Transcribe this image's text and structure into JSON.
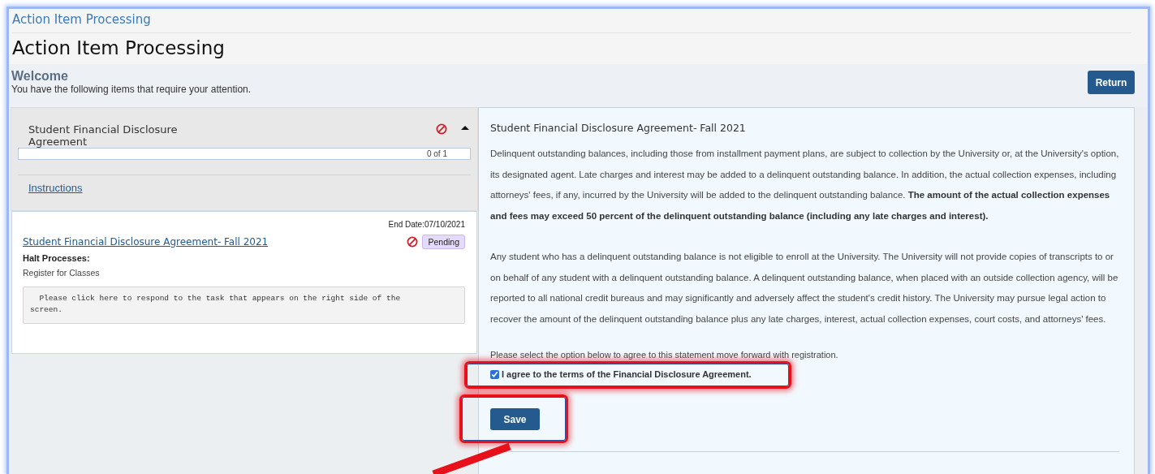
{
  "breadcrumb": "Action Item Processing",
  "page_title": "Action Item Processing",
  "welcome": {
    "heading": "Welcome",
    "message": "You have the following items that require your attention.",
    "return_button": "Return"
  },
  "item_group": {
    "title": "Student Financial Disclosure Agreement",
    "expanded": true,
    "progress": {
      "level": 0,
      "reading": "0 of 1"
    },
    "instructions_link": "Instructions"
  },
  "item_card": {
    "end_date": "End Date:07/10/2021",
    "link": "Student Financial Disclosure Agreement- Fall 2021",
    "status": "Pending",
    "halt_label": "Halt Processes:",
    "halt_process": "Register for Classes",
    "hint": "  Please click here to respond to the task that appears on the right side of the screen."
  },
  "agreement": {
    "title": "Student Financial Disclosure Agreement- Fall 2021",
    "paragraphs": [
      "Delinquent outstanding balances, including those from installment payment plans, are subject to collection by the University or, at the University's option, its designated agent. Late charges and interest may be added to a delinquent outstanding balance. In addition, the actual collection expenses, including attorneys' fees, if any, incurred by the University will be added to the delinquent outstanding balance. **The amount of the actual collection expenses and fees may exceed 50 percent of the delinquent outstanding balance (including any late charges and interest).**",
      "Any student who has a delinquent outstanding balance is not eligible to enroll at the University. The University will not provide copies of transcripts to or on behalf of any student with a delinquent outstanding balance. A delinquent outstanding balance, when placed with an outside collection agency, will be reported to all national credit bureaus and may significantly and adversely affect the student's credit history. The University may pursue legal action to recover the amount of the delinquent outstanding balance plus any late charges, interest, actual collection expenses, court costs, and attorneys' fees."
    ],
    "prompt": "Please select the option below to agree to this statement move forward with registration.",
    "checkbox": {
      "label": "I agree to the terms of the Financial Disclosure Agreement.",
      "checked": true
    },
    "save_button": "Save"
  }
}
